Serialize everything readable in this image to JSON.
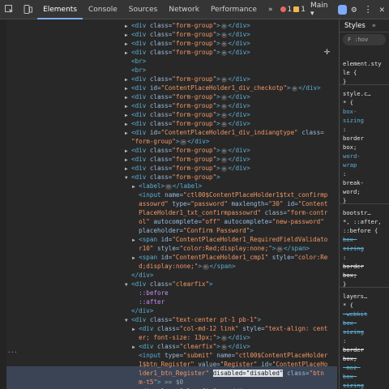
{
  "toolbar": {
    "tabs": [
      "Elements",
      "Console",
      "Sources",
      "Network",
      "Performance"
    ],
    "more": "»",
    "errors": "1",
    "warnings": "1",
    "context": "Main ▾"
  },
  "dom_lines": [
    {
      "html": "<span class='arrow'>▶</span><span class='tag'>&lt;div </span><span class='an'>class</span>=<span class='av'>\"form-group\"</span><span class='tag'>&gt;</span><span class='ell'>⋯</span><span class='tag'>&lt;/div&gt;</span>"
    },
    {
      "html": "<span class='arrow'>▶</span><span class='tag'>&lt;div </span><span class='an'>class</span>=<span class='av'>\"form-group\"</span><span class='tag'>&gt;</span><span class='ell'>⋯</span><span class='tag'>&lt;/div&gt;</span>"
    },
    {
      "html": "<span class='arrow'>▶</span><span class='tag'>&lt;div </span><span class='an'>class</span>=<span class='av'>\"form-group\"</span><span class='tag'>&gt;</span><span class='ell'>⋯</span><span class='tag'>&lt;/div&gt;</span>"
    },
    {
      "html": "<span class='arrow'>▶</span><span class='tag'>&lt;div </span><span class='an'>class</span>=<span class='av'>\"form-group\"</span><span class='tag'>&gt;</span><span class='ell'>⋯</span><span class='tag'>&lt;/div&gt;</span>"
    },
    {
      "html": "<span class='arrow'></span><span class='tag'>&lt;br&gt;</span>"
    },
    {
      "html": "<span class='arrow'></span><span class='tag'>&lt;br&gt;</span>"
    },
    {
      "html": "<span class='arrow'>▶</span><span class='tag'>&lt;div </span><span class='an'>class</span>=<span class='av'>\"form-group\"</span><span class='tag'>&gt;</span><span class='ell'>⋯</span><span class='tag'>&lt;/div&gt;</span>"
    },
    {
      "html": "<span class='arrow'>▶</span><span class='tag'>&lt;div </span><span class='an'>id</span>=<span class='av'>\"ContentPlaceHolder1_div_checkotp\"</span><span class='tag'>&gt;</span><span class='ell'>⋯</span><span class='tag'>&lt;/div&gt;</span>"
    },
    {
      "html": "<span class='arrow'>▶</span><span class='tag'>&lt;div </span><span class='an'>class</span>=<span class='av'>\"form-group\"</span><span class='tag'>&gt;</span><span class='ell'>⋯</span><span class='tag'>&lt;/div&gt;</span>"
    },
    {
      "html": "<span class='arrow'>▶</span><span class='tag'>&lt;div </span><span class='an'>class</span>=<span class='av'>\"form-group\"</span><span class='tag'>&gt;</span><span class='ell'>⋯</span><span class='tag'>&lt;/div&gt;</span>"
    },
    {
      "html": "<span class='arrow'>▶</span><span class='tag'>&lt;div </span><span class='an'>class</span>=<span class='av'>\"form-group\"</span><span class='tag'>&gt;</span><span class='ell'>⋯</span><span class='tag'>&lt;/div&gt;</span>"
    },
    {
      "html": "<span class='arrow'>▶</span><span class='tag'>&lt;div </span><span class='an'>class</span>=<span class='av'>\"form-group\"</span><span class='tag'>&gt;</span><span class='ell'>⋯</span><span class='tag'>&lt;/div&gt;</span>"
    },
    {
      "html": "<span class='arrow'>▶</span><span class='tag'>&lt;div </span><span class='an'>id</span>=<span class='av'>\"ContentPlaceHolder1_div_indiangtype\"</span> <span class='an'>class</span>="
    },
    {
      "html": "<span class='arrow'></span><span class='av'>\"form-group\"</span><span class='tag'>&gt;</span><span class='ell'>⋯</span><span class='tag'>&lt;/div&gt;</span>"
    },
    {
      "html": "<span class='arrow'>▶</span><span class='tag'>&lt;div </span><span class='an'>class</span>=<span class='av'>\"form-group\"</span><span class='tag'>&gt;</span><span class='ell'>⋯</span><span class='tag'>&lt;/div&gt;</span>"
    },
    {
      "html": "<span class='arrow'>▶</span><span class='tag'>&lt;div </span><span class='an'>class</span>=<span class='av'>\"form-group\"</span><span class='tag'>&gt;</span><span class='ell'>⋯</span><span class='tag'>&lt;/div&gt;</span>"
    },
    {
      "html": "<span class='arrow'>▶</span><span class='tag'>&lt;div </span><span class='an'>class</span>=<span class='av'>\"form-group\"</span><span class='tag'>&gt;</span><span class='ell'>⋯</span><span class='tag'>&lt;/div&gt;</span>"
    },
    {
      "html": "<span class='arrow'>▼</span><span class='tag'>&lt;div </span><span class='an'>class</span>=<span class='av'>\"form-group\"</span><span class='tag'>&gt;</span>"
    },
    {
      "html": "&nbsp;&nbsp;<span class='arrow'>▶</span><span class='tag'>&lt;label&gt;</span><span class='ell'>⋯</span><span class='tag'>&lt;/label&gt;</span>"
    },
    {
      "html": "&nbsp;&nbsp;<span class='arrow'></span><span class='tag'>&lt;input </span><span class='an'>name</span>=<span class='av'>\"ctl00$ContentPlaceHolder1$txt_confirmp</span>"
    },
    {
      "html": "&nbsp;&nbsp;<span class='arrow'></span><span class='av'>assowrd\"</span> <span class='an'>type</span>=<span class='av'>\"password\"</span> <span class='an'>maxlength</span>=<span class='av'>\"30\"</span> <span class='an'>id</span>=<span class='av'>\"Content</span>"
    },
    {
      "html": "&nbsp;&nbsp;<span class='arrow'></span><span class='av'>PlaceHolder1_txt_confirmpassowrd\"</span> <span class='an'>class</span>=<span class='av'>\"form-contr</span>"
    },
    {
      "html": "&nbsp;&nbsp;<span class='arrow'></span><span class='av'>ol\"</span> <span class='an'>autocomplete</span>=<span class='av'>\"off\"</span> <span class='an'>autocomplete</span>=<span class='av'>\"new-password\"</span>"
    },
    {
      "html": "&nbsp;&nbsp;<span class='arrow'></span><span class='an'>placeholder</span>=<span class='av'>\"Confirm Password\"</span><span class='tag'>&gt;</span>"
    },
    {
      "html": "&nbsp;&nbsp;<span class='arrow'>▶</span><span class='tag'>&lt;span </span><span class='an'>id</span>=<span class='av'>\"ContentPlaceHolder1_RequiredFieldValidato</span>"
    },
    {
      "html": "&nbsp;&nbsp;<span class='arrow'></span><span class='av'>r10\"</span> <span class='an'>style</span>=<span class='av'>\"color:Red;display:none;\"</span><span class='tag'>&gt;</span><span class='ell'>⋯</span><span class='tag'>&lt;/span&gt;</span>"
    },
    {
      "html": "&nbsp;&nbsp;<span class='arrow'>▶</span><span class='tag'>&lt;span </span><span class='an'>id</span>=<span class='av'>\"ContentPlaceHolder1_cmp1\"</span> <span class='an'>style</span>=<span class='av'>\"color:Re</span>"
    },
    {
      "html": "&nbsp;&nbsp;<span class='arrow'></span><span class='av'>d;display:none;\"</span><span class='tag'>&gt;</span><span class='ell'>⋯</span><span class='tag'>&lt;/span&gt;</span>"
    },
    {
      "html": "<span class='arrow'></span><span class='tag'>&lt;/div&gt;</span>"
    },
    {
      "html": "<span class='arrow'>▼</span><span class='tag'>&lt;div </span><span class='an'>class</span>=<span class='av'>\"clearfix\"</span><span class='tag'>&gt;</span>"
    },
    {
      "html": "&nbsp;&nbsp;<span class='arrow'></span><span class='pseudo'>::before</span>"
    },
    {
      "html": "&nbsp;&nbsp;<span class='arrow'></span><span class='pseudo'>::after</span>"
    },
    {
      "html": "<span class='arrow'></span><span class='tag'>&lt;/div&gt;</span>"
    },
    {
      "html": "<span class='arrow'>▼</span><span class='tag'>&lt;div </span><span class='an'>class</span>=<span class='av'>\"text-center pt-1 pb-1\"</span><span class='tag'>&gt;</span>"
    },
    {
      "html": "&nbsp;&nbsp;<span class='arrow'>▶</span><span class='tag'>&lt;div </span><span class='an'>class</span>=<span class='av'>\"col-md-12 link\"</span> <span class='an'>style</span>=<span class='av'>\"text-align: cent</span>"
    },
    {
      "html": "&nbsp;&nbsp;<span class='arrow'></span><span class='av'>er; font-size: 13px;\"</span><span class='tag'>&gt;</span><span class='ell'>⋯</span><span class='tag'>&lt;/div&gt;</span>"
    },
    {
      "html": "&nbsp;&nbsp;<span class='arrow'>▶</span><span class='tag'>&lt;div </span><span class='an'>class</span>=<span class='av'>\"clearfix\"</span><span class='tag'>&gt;</span><span class='ell'>⋯</span><span class='tag'>&lt;/div&gt;</span>"
    },
    {
      "html": "&nbsp;&nbsp;<span class='arrow'></span><span class='tag'>&lt;input </span><span class='an'>type</span>=<span class='av'>\"submit\"</span> <span class='an'>name</span>=<span class='av'>\"ctl00$ContentPlaceHolder</span>"
    },
    {
      "html": "&nbsp;&nbsp;<span class='arrow'></span><span class='av'>1$btn_Register\"</span> <span class='an'>value</span>=<span class='av'>\"Register\"</span> <span class='an'>id</span>=<span class='av'>\"ContentPlaceHo</span>"
    },
    {
      "html": "&nbsp;&nbsp;<span class='arrow'></span><span class='av'>lder1_btn_Register\"</span> <span class='hl'>disabled=\"disabled\"</span> <span class='an'>class</span>=<span class='av'>\"btn</span>"
    },
    {
      "html": "&nbsp;&nbsp;<span class='arrow'></span><span class='av'>m-t5\"</span><span class='tag'>&gt;</span> <span class='gt'>== $0</span>"
    },
    {
      "html": "&nbsp;&nbsp;<span class='arrow'>▶</span><span class='tag'>&lt;div </span><span class='an'>class</span>=<span class='av'>\"clearfix\"</span><span class='tag'>&gt;</span><span class='ell'>⋯</span><span class='tag'>&lt;/div&gt;</span>"
    }
  ],
  "styles": {
    "tab_label": "Styles",
    "more": "»",
    "filter_text": "F  :hov",
    "lines": [
      {
        "t": "element.sty",
        "c": "rv"
      },
      {
        "t": "le {",
        "c": "rv"
      },
      {
        "t": "}",
        "c": "rv"
      },
      {
        "t": "style.c…",
        "c": "rv"
      },
      {
        "t": "* {",
        "c": "rv"
      },
      {
        "t": "  box-",
        "c": "rp"
      },
      {
        "t": "  sizing",
        "c": "rp"
      },
      {
        "t": "  :",
        "c": "rv"
      },
      {
        "t": "  border",
        "c": "rv"
      },
      {
        "t": "  box;",
        "c": "rv"
      },
      {
        "t": "  word-",
        "c": "rp"
      },
      {
        "t": "  wrap",
        "c": "rp"
      },
      {
        "t": "  :",
        "c": "rv"
      },
      {
        "t": "  break-",
        "c": "rv"
      },
      {
        "t": "  word;",
        "c": "rv"
      },
      {
        "t": "}",
        "c": "rv"
      },
      {
        "t": "bootstr…",
        "c": "rv"
      },
      {
        "t": "*, ::after,",
        "c": "rv"
      },
      {
        "t": "::before {",
        "c": "rv"
      },
      {
        "t": "  box-",
        "c": "rp strike"
      },
      {
        "t": "  sizing",
        "c": "rp strike"
      },
      {
        "t": "  :",
        "c": "rv"
      },
      {
        "t": "  border",
        "c": "rv strike"
      },
      {
        "t": "  box;",
        "c": "rv strike"
      },
      {
        "t": "}",
        "c": "rv"
      },
      {
        "t": "layers…",
        "c": "rv"
      },
      {
        "t": "* {",
        "c": "rv"
      },
      {
        "t": "  -webkit",
        "c": "rp strike"
      },
      {
        "t": "  box-",
        "c": "rp strike"
      },
      {
        "t": "  sizing",
        "c": "rp strike"
      },
      {
        "t": "  :",
        "c": "rv"
      },
      {
        "t": "  border",
        "c": "rv strike"
      },
      {
        "t": "  box;",
        "c": "rv strike"
      },
      {
        "t": "  -moz-",
        "c": "rp strike"
      },
      {
        "t": "  box-",
        "c": "rp strike"
      },
      {
        "t": "  sizing",
        "c": "rp strike"
      }
    ]
  }
}
